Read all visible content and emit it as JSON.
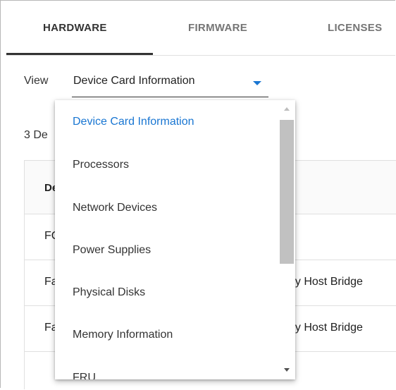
{
  "tabs": [
    {
      "label": "HARDWARE",
      "active": true
    },
    {
      "label": "FIRMWARE",
      "active": false
    },
    {
      "label": "LICENSES",
      "active": false
    }
  ],
  "view": {
    "label": "View",
    "selected": "Device Card Information"
  },
  "background": {
    "count_text": "3 De",
    "table": {
      "header": "De",
      "rows": [
        {
          "c1": "FC",
          "c2": ""
        },
        {
          "c1": "Fa",
          "c2": "ny Host Bridge"
        },
        {
          "c1": "Fa",
          "c2": "ny Host Bridge"
        },
        {
          "c1": "",
          "c2": ""
        }
      ]
    }
  },
  "dropdown": {
    "options": [
      "Device Card Information",
      "Processors",
      "Network Devices",
      "Power Supplies",
      "Physical Disks",
      "Memory Information",
      "FRU"
    ],
    "selected_index": 0
  },
  "colors": {
    "accent": "#1976d2",
    "active_tab": "#333333",
    "inactive_tab": "#757575",
    "scroll_thumb": "#c1c1c1"
  }
}
